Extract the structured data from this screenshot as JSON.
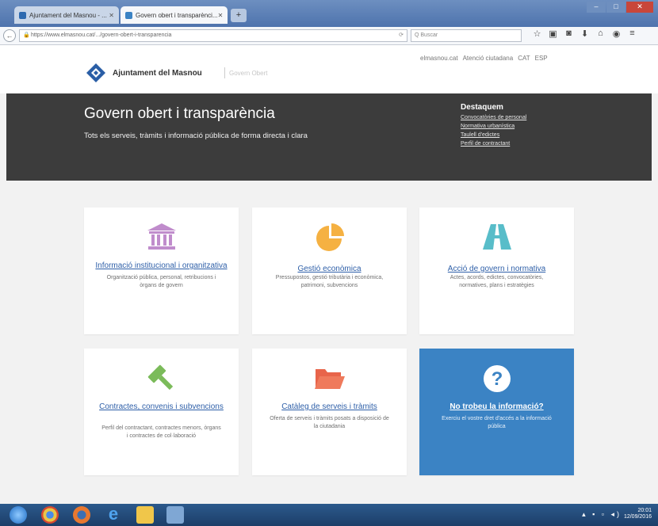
{
  "browser": {
    "tabs": [
      {
        "label": "Ajuntament del Masnou - ...",
        "active": false
      },
      {
        "label": "Govern obert i transparènci...",
        "active": true
      }
    ],
    "new_tab": "+",
    "url": "https://www.elmasnou.cat/.../govern-obert-i-transparencia",
    "search_placeholder": "Q Buscar"
  },
  "header": {
    "brand": "Ajuntament del Masnou",
    "brand_sub": "Govern Obert",
    "top_links": [
      "elmasnou.cat",
      "Atenció ciutadana",
      "CAT",
      "ESP"
    ]
  },
  "hero": {
    "title": "Govern obert i transparència",
    "subtitle": "Tots els serveis, tràmits i informació pública de forma directa i clara",
    "highlights_title": "Destaquem",
    "highlights": [
      "Convocatòries de personal",
      "Normativa urbanística",
      "Taulell d'edictes",
      "Perfil de contractant"
    ]
  },
  "cards": [
    {
      "title": "Informació institucional i organitzativa",
      "desc": "Organització pública, personal, retribucions i òrgans de govern",
      "icon": "institution-icon",
      "color": "#c08ccc"
    },
    {
      "title": "Gestió econòmica",
      "desc": "Pressupostos, gestió tributària i econòmica, patrimoni, subvencions",
      "icon": "pie-chart-icon",
      "color": "#f5b142"
    },
    {
      "title": "Acció de govern i normativa",
      "desc": "Actes, acords, edictes, convocatòries, normatives, plans i estratègies",
      "icon": "road-icon",
      "color": "#58bdc9"
    },
    {
      "title": "Contractes, convenis i subvencions",
      "desc": "Perfil del contractant, contractes menors, òrgans i contractes de col·laboració",
      "icon": "gavel-icon",
      "color": "#7bbb5a"
    },
    {
      "title": "Catàleg de serveis i tràmits",
      "desc": "Oferta de serveis i tràmits posats a disposició de la ciutadania",
      "icon": "folder-icon",
      "color": "#e8644a"
    },
    {
      "title": "No trobeu la informació?",
      "desc": "Exerciu el vostre dret d'accés a la informació pública",
      "icon": "question-icon",
      "color": "#ffffff"
    }
  ],
  "taskbar": {
    "time": "20:01",
    "date": "12/09/2016"
  }
}
